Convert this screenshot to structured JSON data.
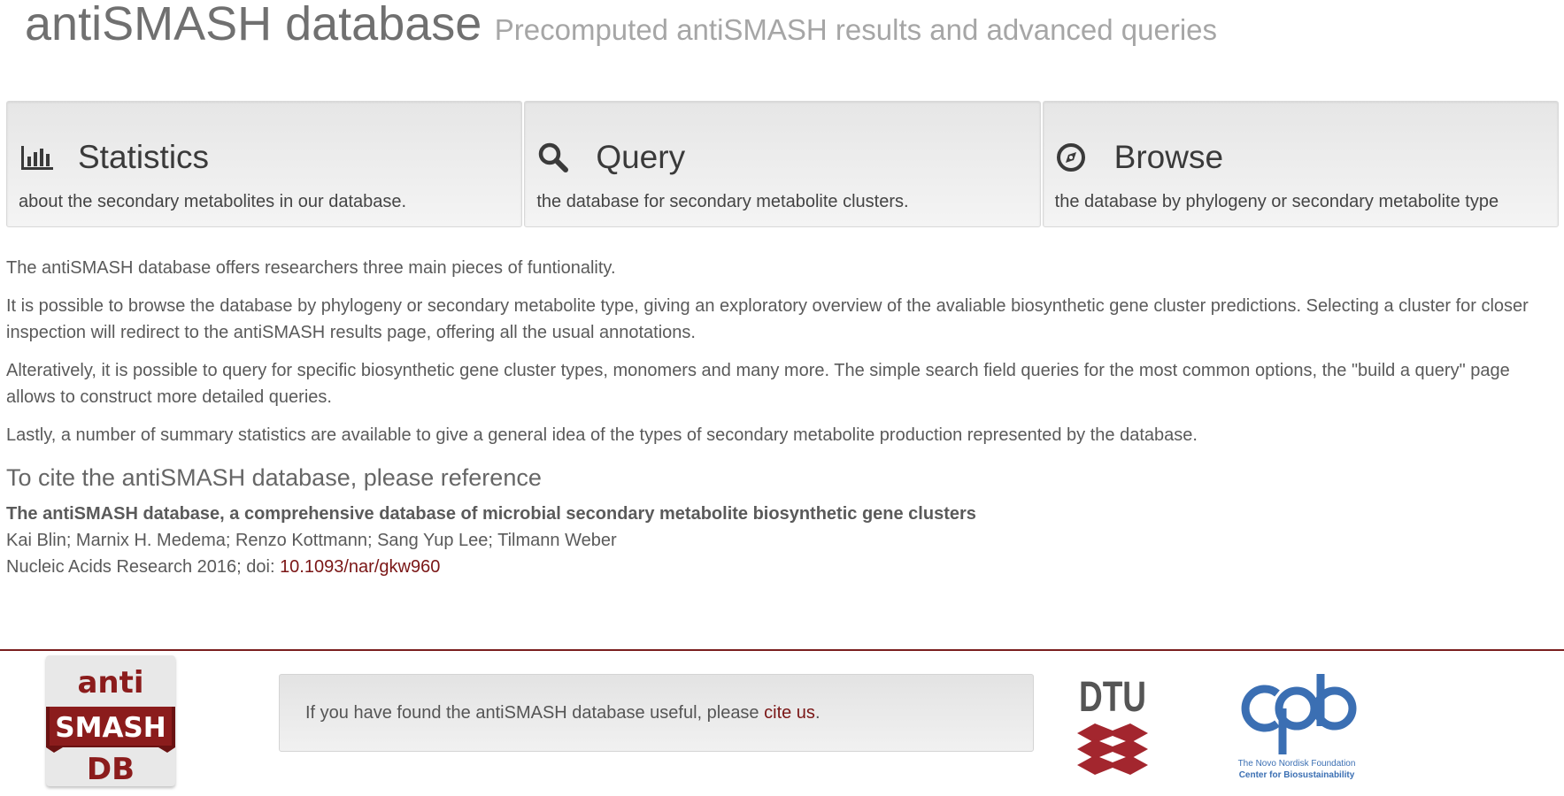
{
  "header": {
    "title": "antiSMASH database",
    "subtitle": "Precomputed antiSMASH results and advanced queries"
  },
  "cards": [
    {
      "title": "Statistics",
      "description": "about the secondary metabolites in our database.",
      "icon": "bar-chart-icon"
    },
    {
      "title": "Query",
      "description": "the database for secondary metabolite clusters.",
      "icon": "search-icon"
    },
    {
      "title": "Browse",
      "description": "the database by phylogeny or secondary metabolite type",
      "icon": "compass-icon"
    }
  ],
  "intro": {
    "p1": "The antiSMASH database offers researchers three main pieces of funtionality.",
    "p2": "It is possible to browse the database by phylogeny or secondary metabolite type, giving an exploratory overview of the avaliable biosynthetic gene cluster predictions. Selecting a cluster for closer inspection will redirect to the antiSMASH results page, offering all the usual annotations.",
    "p3": "Alteratively, it is possible to query for specific biosynthetic gene cluster types, monomers and many more. The simple search field queries for the most common options, the \"build a query\" page allows to construct more detailed queries.",
    "p4": "Lastly, a number of summary statistics are available to give a general idea of the types of secondary metabolite production represented by the database."
  },
  "citation": {
    "heading": "To cite the antiSMASH database, please reference",
    "title": "The antiSMASH database, a comprehensive database of microbial secondary metabolite biosynthetic gene clusters",
    "authors": "Kai Blin; Marnix H. Medema; Renzo Kottmann; Sang Yup Lee; Tilmann Weber",
    "journal_prefix": "Nucleic Acids Research 2016; doi: ",
    "doi": "10.1093/nar/gkw960"
  },
  "footer": {
    "logo_lines": [
      "anti",
      "SMASH",
      "DB"
    ],
    "notice_prefix": "If you have found the antiSMASH database useful, please ",
    "notice_link": "cite us",
    "notice_suffix": ".",
    "dtu_logo_text": "DTU",
    "cfb_line1": "The Novo Nordisk Foundation",
    "cfb_line2": "Center for Biosustainability"
  },
  "colors": {
    "brand_red": "#8b1c1c",
    "link": "#7a1616",
    "dtu_red": "#a3262e",
    "cfb_blue": "#3b6fb3"
  }
}
